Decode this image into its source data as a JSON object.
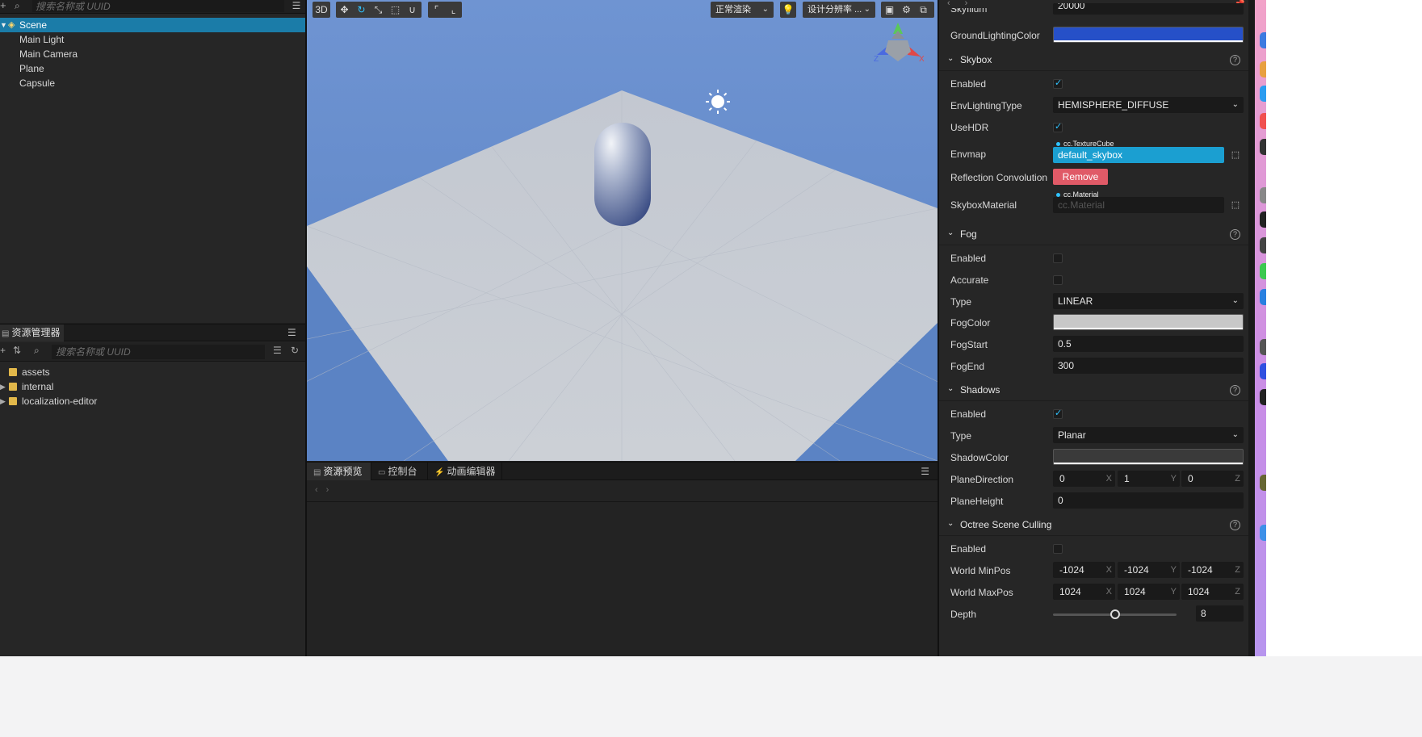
{
  "hierarchy": {
    "search_placeholder": "搜索名称或 UUID",
    "items": [
      {
        "label": "Scene"
      },
      {
        "label": "Main Light"
      },
      {
        "label": "Main Camera"
      },
      {
        "label": "Plane"
      },
      {
        "label": "Capsule"
      }
    ]
  },
  "assets": {
    "tab_label": "资源管理器",
    "search_placeholder": "搜索名称或 UUID",
    "items": [
      {
        "label": "assets"
      },
      {
        "label": "internal"
      },
      {
        "label": "localization-editor"
      }
    ]
  },
  "viewport": {
    "mode_label": "3D",
    "render_select": "正常渲染",
    "resolution_select": "设计分辨率 ...",
    "gizmo_axes": {
      "x": "X",
      "y": "Y",
      "z": "Z"
    },
    "colors": {
      "sky_top": "#6f94d2",
      "plane": "#c8ccd3",
      "capsule": "#4a5f93"
    }
  },
  "bottom_panel": {
    "tabs": [
      {
        "label": "资源预览"
      },
      {
        "label": "控制台"
      },
      {
        "label": "动画编辑器"
      }
    ]
  },
  "inspector": {
    "sky_illum_label": "SkyIllum",
    "sky_illum_value": "20000",
    "ground_lighting_label": "GroundLightingColor",
    "ground_lighting_color": "#2650c8",
    "skybox": {
      "title": "Skybox",
      "enabled_label": "Enabled",
      "enabled": true,
      "env_lighting_label": "EnvLightingType",
      "env_lighting_value": "HEMISPHERE_DIFFUSE",
      "use_hdr_label": "UseHDR",
      "use_hdr": true,
      "envmap_label": "Envmap",
      "envmap_type": "cc.TextureCube",
      "envmap_value": "default_skybox",
      "reflection_label": "Reflection Convolution",
      "remove_label": "Remove",
      "material_label": "SkyboxMaterial",
      "material_type": "cc.Material",
      "material_placeholder": "cc.Material"
    },
    "fog": {
      "title": "Fog",
      "enabled_label": "Enabled",
      "enabled": false,
      "accurate_label": "Accurate",
      "accurate": false,
      "type_label": "Type",
      "type_value": "LINEAR",
      "color_label": "FogColor",
      "color": "#c8c8c8",
      "start_label": "FogStart",
      "start_value": "0.5",
      "end_label": "FogEnd",
      "end_value": "300"
    },
    "shadows": {
      "title": "Shadows",
      "enabled_label": "Enabled",
      "enabled": true,
      "type_label": "Type",
      "type_value": "Planar",
      "color_label": "ShadowColor",
      "color": "#3a3a3a",
      "plane_dir_label": "PlaneDirection",
      "plane_dir": [
        "0",
        "1",
        "0"
      ],
      "plane_height_label": "PlaneHeight",
      "plane_height_value": "0"
    },
    "octree": {
      "title": "Octree Scene Culling",
      "enabled_label": "Enabled",
      "enabled": false,
      "min_label": "World MinPos",
      "min": [
        "-1024",
        "-1024",
        "-1024"
      ],
      "max_label": "World MaxPos",
      "max": [
        "1024",
        "1024",
        "1024"
      ],
      "depth_label": "Depth",
      "depth_value": "8",
      "depth_fraction": 0.5
    },
    "axis_labels": [
      "X",
      "Y",
      "Z"
    ]
  }
}
